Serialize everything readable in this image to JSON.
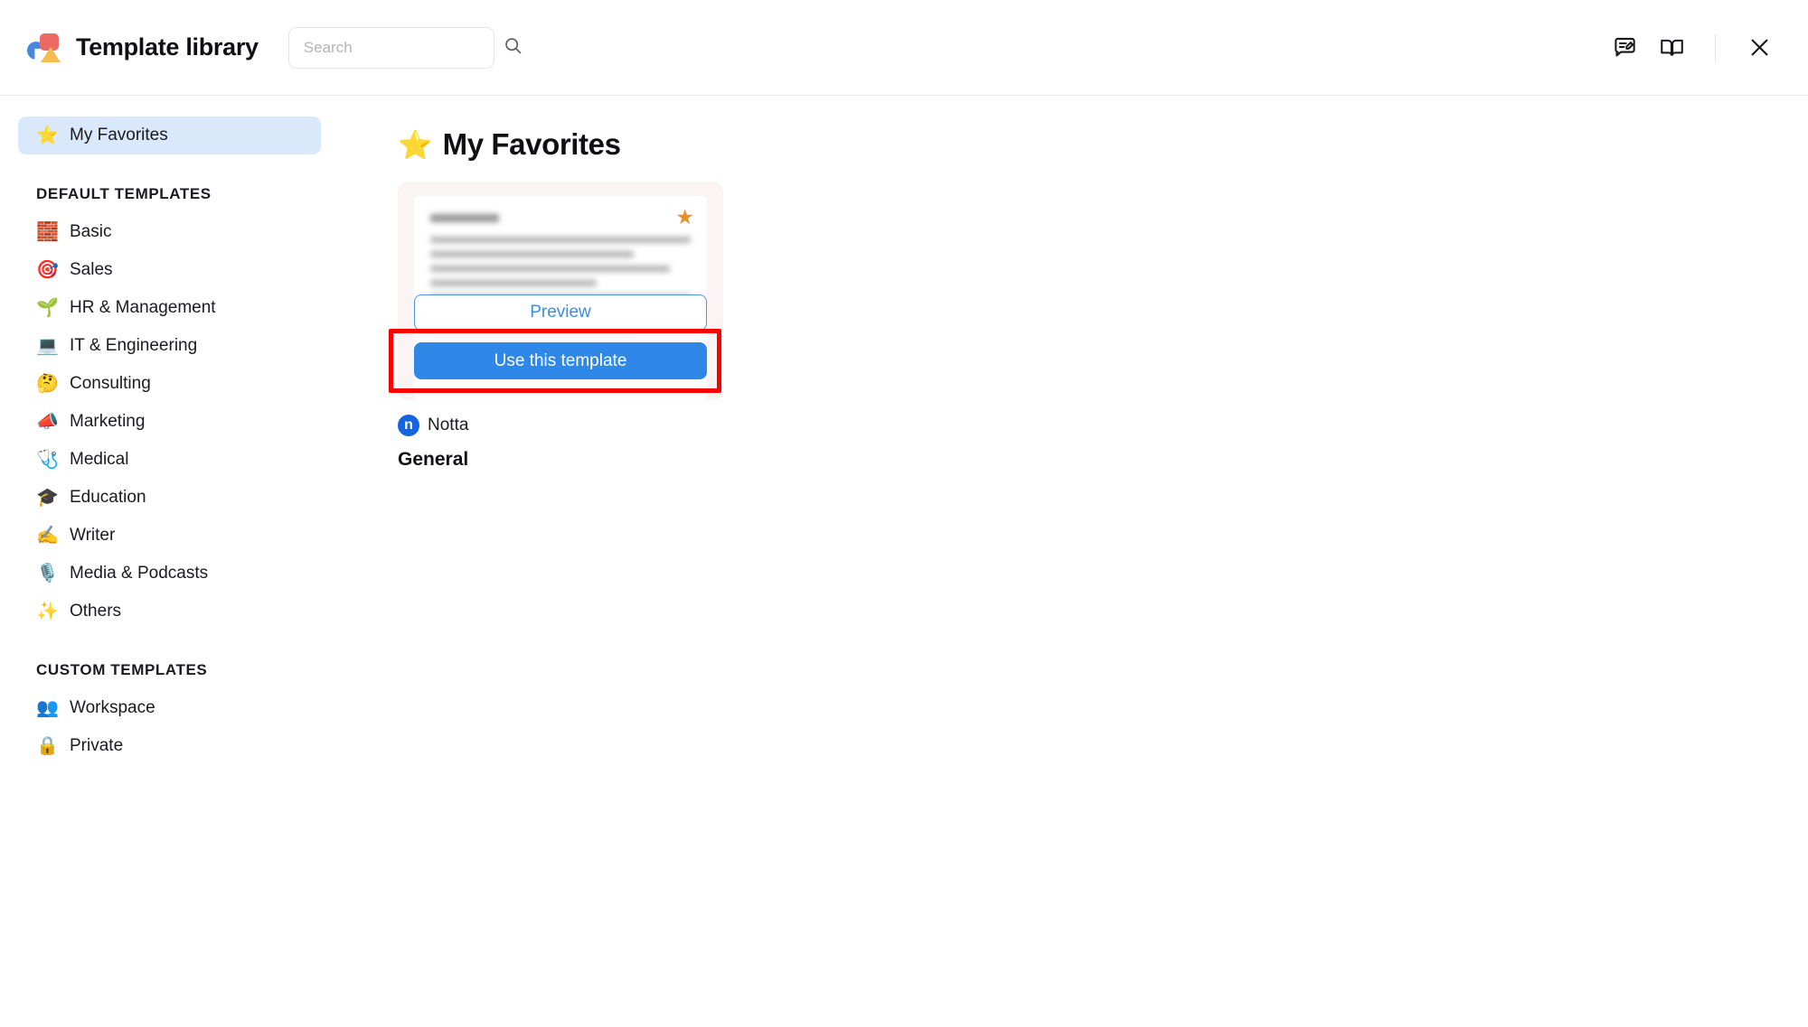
{
  "header": {
    "logo_icon": "notta-template-logo-icon",
    "title": "Template library",
    "search": {
      "placeholder": "Search",
      "value": "",
      "icon": "search-icon"
    },
    "actions": [
      {
        "name": "feedback-icon",
        "label": "Feedback"
      },
      {
        "name": "book-icon",
        "label": "Guide"
      },
      {
        "name": "close-icon",
        "label": "Close"
      }
    ]
  },
  "sidebar": {
    "favorites": {
      "emoji": "⭐",
      "label": "My Favorites",
      "active": true
    },
    "sections": [
      {
        "title": "DEFAULT TEMPLATES",
        "items": [
          {
            "emoji": "🧱",
            "label": "Basic"
          },
          {
            "emoji": "🎯",
            "label": "Sales"
          },
          {
            "emoji": "🌱",
            "label": "HR & Management"
          },
          {
            "emoji": "💻",
            "label": "IT & Engineering"
          },
          {
            "emoji": "🤔",
            "label": "Consulting"
          },
          {
            "emoji": "📣",
            "label": "Marketing"
          },
          {
            "emoji": "🩺",
            "label": "Medical"
          },
          {
            "emoji": "🎓",
            "label": "Education"
          },
          {
            "emoji": "✍️",
            "label": "Writer"
          },
          {
            "emoji": "🎙️",
            "label": "Media & Podcasts"
          },
          {
            "emoji": "✨",
            "label": "Others"
          }
        ]
      },
      {
        "title": "CUSTOM TEMPLATES",
        "items": [
          {
            "emoji": "👥",
            "label": "Workspace"
          },
          {
            "emoji": "🔒",
            "label": "Private"
          }
        ]
      }
    ]
  },
  "main": {
    "page_title": {
      "emoji": "⭐",
      "text": "My Favorites"
    },
    "card": {
      "preview_heading": "Summary",
      "favorite_star": "★",
      "favorite_star_color": "#e7912d",
      "preview_button": "Preview",
      "use_button": "Use this template",
      "use_button_color": "#2f88e8",
      "highlight_color": "#fb0000",
      "author_initial": "n",
      "author": "Notta",
      "category": "General"
    }
  }
}
